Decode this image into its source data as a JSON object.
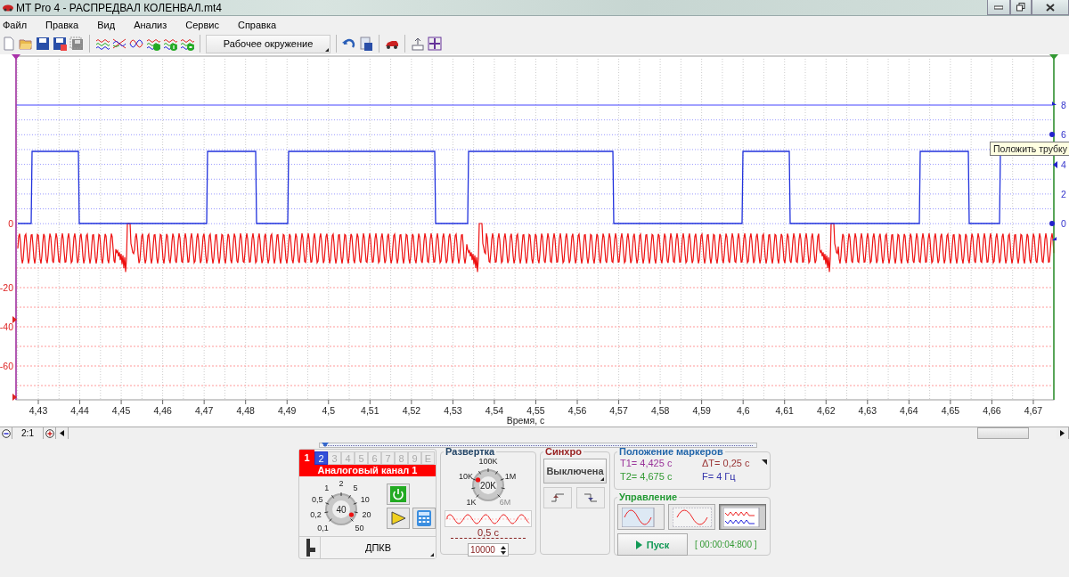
{
  "window": {
    "title": "MT Pro 4 - РАСПРЕДВАЛ КОЛЕНВАЛ.mt4"
  },
  "menu": [
    "Файл",
    "Правка",
    "Вид",
    "Анализ",
    "Сервис",
    "Справка"
  ],
  "toolbar": {
    "workspace": "Рабочее окружение"
  },
  "scope": {
    "x_ticks": [
      "4,43",
      "4,44",
      "4,45",
      "4,46",
      "4,47",
      "4,48",
      "4,49",
      "4,5",
      "4,51",
      "4,52",
      "4,53",
      "4,54",
      "4,55",
      "4,56",
      "4,57",
      "4,58",
      "4,59",
      "4,6",
      "4,61",
      "4,62",
      "4,63",
      "4,64",
      "4,65",
      "4,66",
      "4,67"
    ],
    "xlabel": "Время, с",
    "left_ticks": [
      "0",
      "-20",
      "-40",
      "-60"
    ],
    "right_ticks": [
      "8",
      "6",
      "4",
      "2",
      "0"
    ],
    "tooltip": "Положить трубку"
  },
  "zoom": {
    "ratio": "2:1"
  },
  "panel_slider": {
    "level": 0
  },
  "channel_panel": {
    "tabs": [
      {
        "label": "1",
        "selected": true,
        "enabled": true
      },
      {
        "label": "2",
        "selected": false,
        "enabled": true
      },
      {
        "label": "3",
        "selected": false,
        "enabled": false
      },
      {
        "label": "4",
        "selected": false,
        "enabled": false
      },
      {
        "label": "5",
        "selected": false,
        "enabled": false
      },
      {
        "label": "6",
        "selected": false,
        "enabled": false
      },
      {
        "label": "7",
        "selected": false,
        "enabled": false
      },
      {
        "label": "8",
        "selected": false,
        "enabled": false
      },
      {
        "label": "9",
        "selected": false,
        "enabled": false
      },
      {
        "label": "E",
        "selected": false,
        "enabled": false
      }
    ],
    "title": "Аналоговый канал 1",
    "knob_labels": [
      "0,1",
      "0,2",
      "0,5",
      "1",
      "2",
      "5",
      "10",
      "20",
      "50"
    ],
    "knob_value": "40",
    "sensor": "ДПКВ"
  },
  "sweep": {
    "title": "Развертка",
    "knob_labels": [
      {
        "label": "1K",
        "disabled": false
      },
      {
        "label": "10K",
        "disabled": false
      },
      {
        "label": "100K",
        "disabled": false
      },
      {
        "label": "1M",
        "disabled": false
      },
      {
        "label": "6M",
        "disabled": true
      }
    ],
    "knob_value": "20K",
    "period": "0,5 с",
    "points": "10000"
  },
  "sync": {
    "title": "Синхро",
    "mode": "Выключена"
  },
  "markers": {
    "title": "Положение маркеров",
    "items": [
      {
        "label": "T1= 4,425 с",
        "color": "#993399"
      },
      {
        "label": "ΔT= 0,25 с",
        "color": "#993333"
      },
      {
        "label": "T2= 4,675 с",
        "color": "#339933"
      },
      {
        "label": "F= 4 Гц",
        "color": "#3333aa"
      }
    ]
  },
  "control": {
    "title": "Управление",
    "modes": [
      {
        "kind": "single",
        "selected": false
      },
      {
        "kind": "scroll",
        "selected": false
      },
      {
        "kind": "multi",
        "selected": true
      }
    ],
    "start": "Пуск",
    "elapsed": "[ 00:00:04:800 ]"
  }
}
